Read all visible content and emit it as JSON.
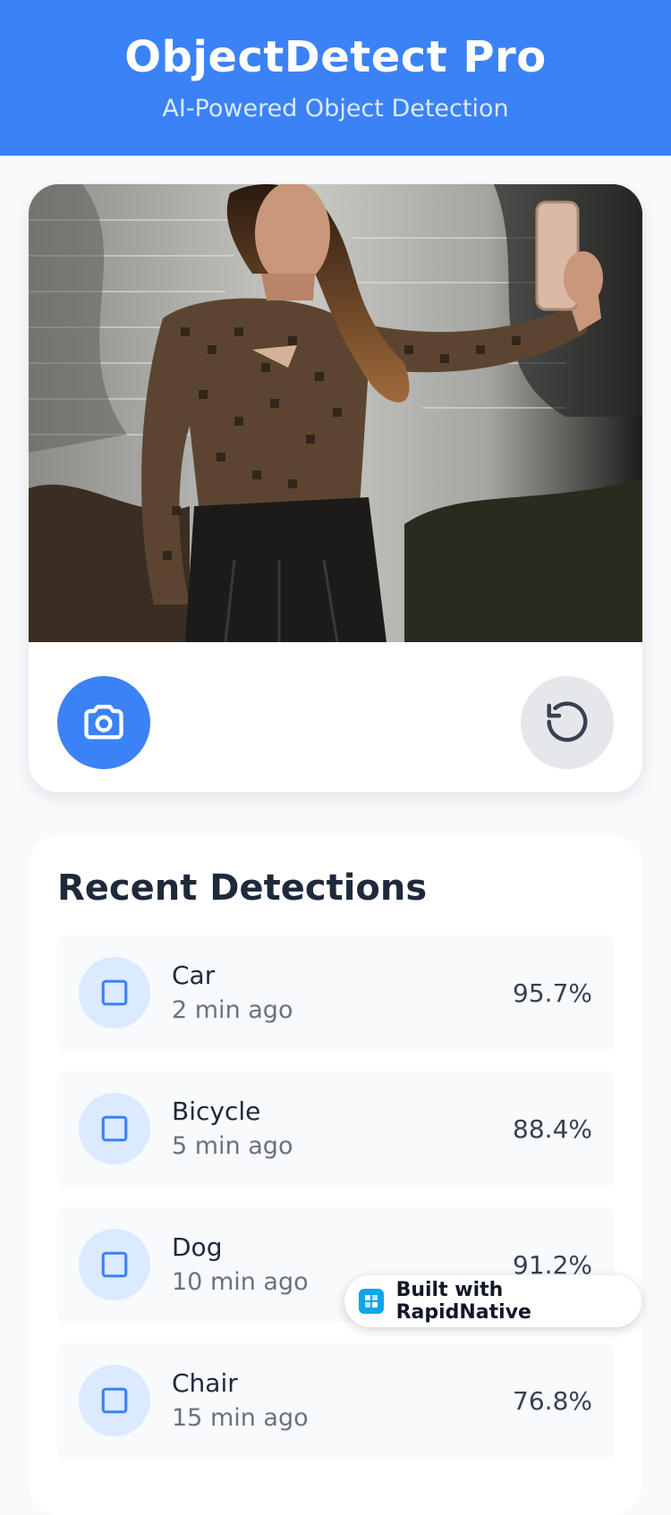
{
  "header": {
    "title": "ObjectDetect Pro",
    "subtitle": "AI-Powered Object Detection"
  },
  "camera": {
    "capture_icon": "camera-icon",
    "reset_icon": "rotate-ccw-icon"
  },
  "recent": {
    "title": "Recent Detections",
    "items": [
      {
        "name": "Car",
        "time": "2 min ago",
        "confidence": "95.7%"
      },
      {
        "name": "Bicycle",
        "time": "5 min ago",
        "confidence": "88.4%"
      },
      {
        "name": "Dog",
        "time": "10 min ago",
        "confidence": "91.2%"
      },
      {
        "name": "Chair",
        "time": "15 min ago",
        "confidence": "76.8%"
      }
    ],
    "item_icon": "square-icon"
  },
  "badge": {
    "label": "Built with RapidNative",
    "icon": "rapidnative-logo-icon"
  },
  "colors": {
    "primary": "#3b82f6",
    "icon_bg": "#dbeafe",
    "text_dark": "#1e293b",
    "text_muted": "#6b7280"
  }
}
